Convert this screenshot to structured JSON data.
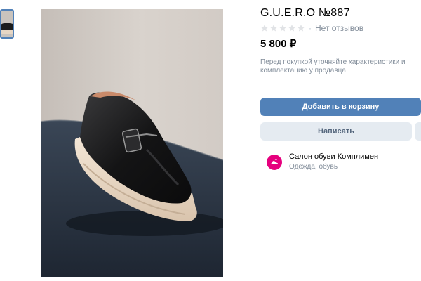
{
  "product": {
    "title": "G.U.E.R.O №887",
    "reviews_text": "Нет отзывов",
    "rating_stars": 0,
    "rating_separator": "·",
    "price": "5 800 ₽",
    "note": "Перед покупкой уточняйте характеристики и комплектацию у продавца"
  },
  "actions": {
    "add_to_cart": "Добавить в корзину",
    "write": "Написать"
  },
  "seller": {
    "name": "Салон обуви Комплимент",
    "category": "Одежда, обувь"
  },
  "gallery": {
    "thumbnail_icon": "shoe-thumbnail",
    "photo_subject": "shoe-photo"
  },
  "colors": {
    "accent": "#5181b8",
    "secondary_button": "#e5ebf1",
    "muted_text": "#818c99",
    "seller_avatar": "#e6007e"
  }
}
